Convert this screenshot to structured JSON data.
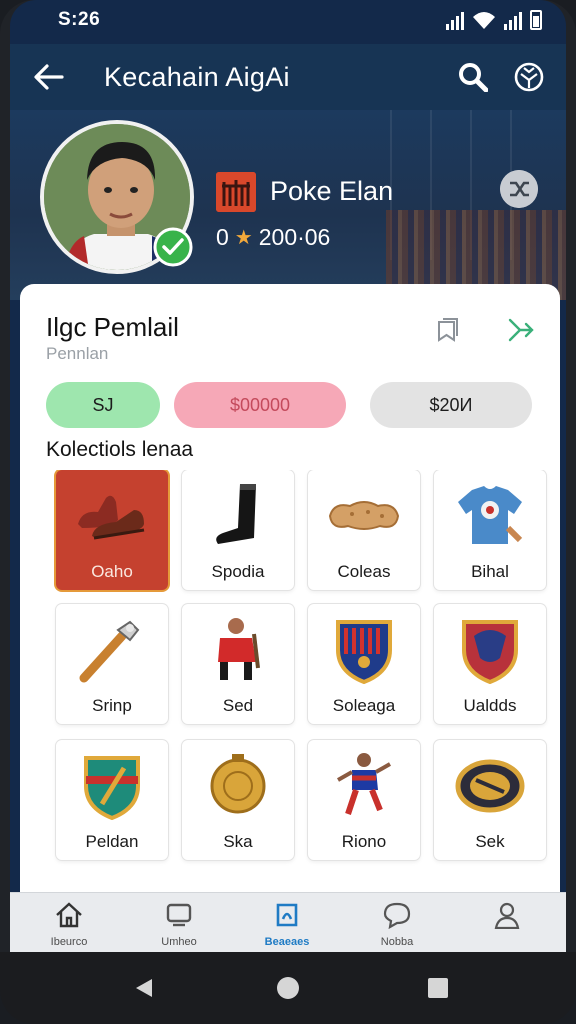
{
  "status_bar": {
    "time": "S:26",
    "icons": [
      "signal-icon",
      "wifi-icon",
      "signal-icon",
      "battery-icon"
    ]
  },
  "app_bar": {
    "title": "Kecahain AigAi",
    "icons": [
      "back-arrow-icon",
      "search-icon",
      "soccer-ball-icon"
    ]
  },
  "profile": {
    "clan_name": "Poke Elan",
    "score_prefix": "0",
    "score_value": "200·06",
    "verified": true
  },
  "card": {
    "title": "Ilgc Pemlail",
    "subtitle": "Pennlan",
    "pills": [
      {
        "label": "SJ",
        "color": "#9ee6ae"
      },
      {
        "label": "$00000",
        "color": "#f6a8b7"
      },
      {
        "label": "$20И",
        "color": "#e3e3e3"
      }
    ],
    "section_title": "Kolectiols lenaa",
    "items": [
      {
        "label": "Oaho",
        "icon": "shoes-icon",
        "selected": true
      },
      {
        "label": "Spodia",
        "icon": "boot-icon"
      },
      {
        "label": "Coleas",
        "icon": "bread-icon"
      },
      {
        "label": "Bihal",
        "icon": "jersey-icon"
      },
      {
        "label": "Srinp",
        "icon": "torch-icon"
      },
      {
        "label": "Sed",
        "icon": "player-icon"
      },
      {
        "label": "Soleaga",
        "icon": "crest-icon"
      },
      {
        "label": "Ualdds",
        "icon": "shield-icon"
      },
      {
        "label": "Peldan",
        "icon": "badge-icon"
      },
      {
        "label": "Ska",
        "icon": "medal-icon"
      },
      {
        "label": "Riono",
        "icon": "footballer-icon"
      },
      {
        "label": "Sek",
        "icon": "ball-icon"
      }
    ]
  },
  "bottom_nav": [
    {
      "label": "Ibeurco",
      "icon": "home-icon"
    },
    {
      "label": "Umheo",
      "icon": "tv-icon"
    },
    {
      "label": "Beaeaes",
      "icon": "gem-icon",
      "active": true
    },
    {
      "label": "Nobba",
      "icon": "chat-icon"
    },
    {
      "label": "",
      "icon": "profile-icon"
    }
  ],
  "colors": {
    "app_bar": "#173454",
    "accent": "#1f7bc4",
    "verified": "#38b34a"
  }
}
